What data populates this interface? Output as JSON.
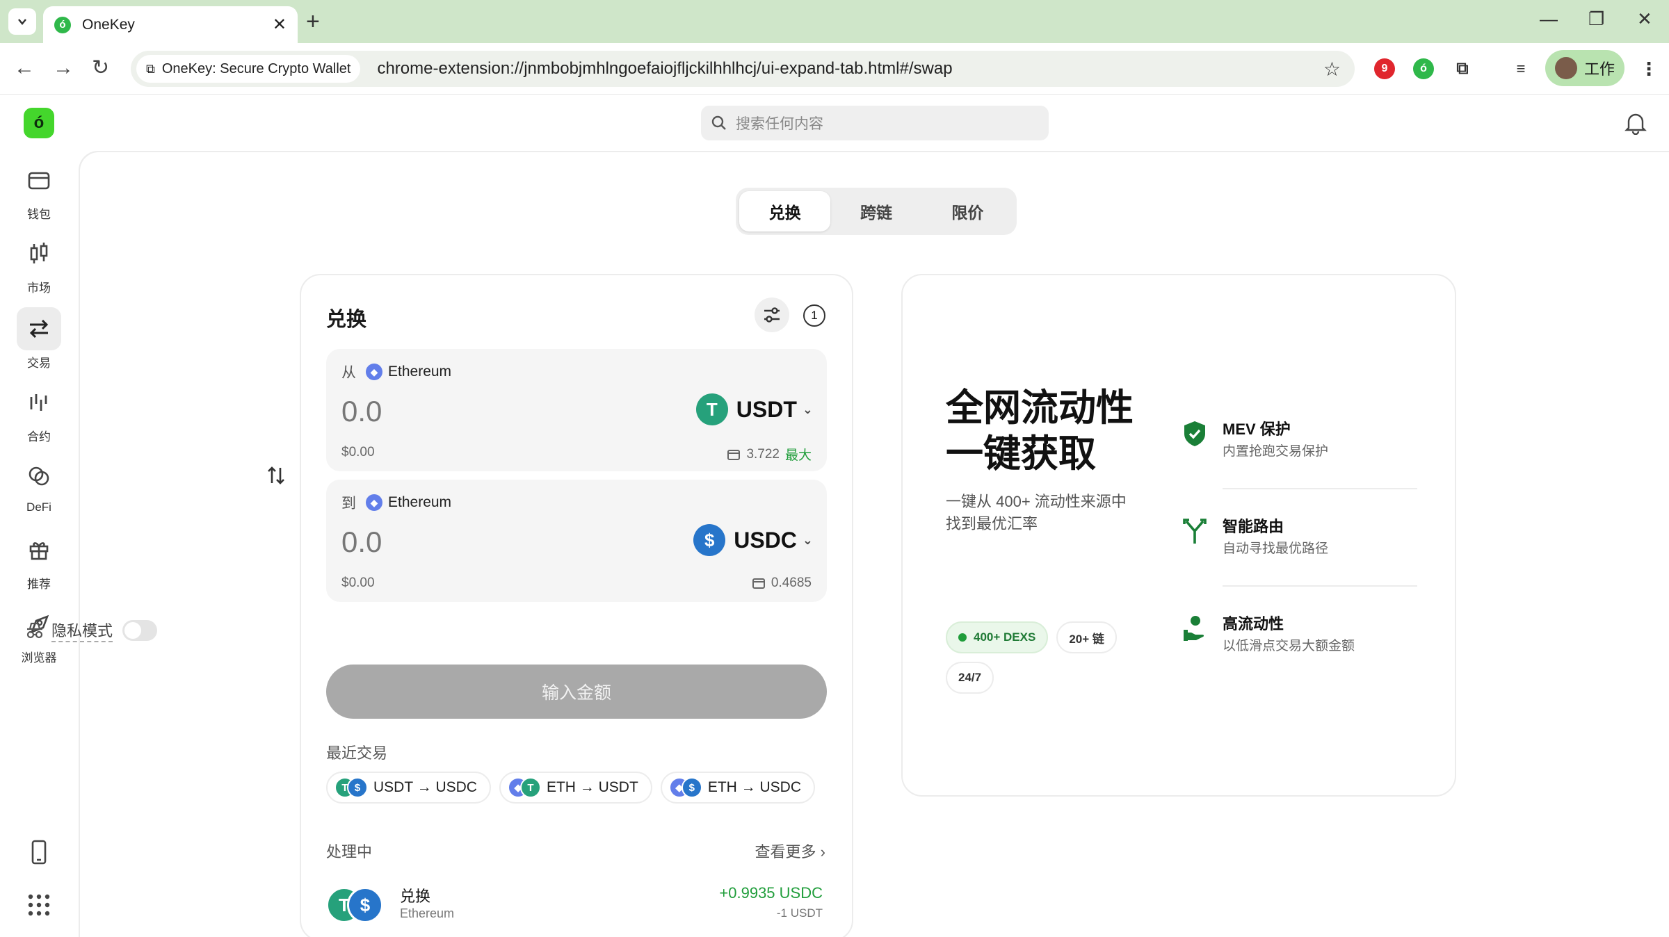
{
  "browser": {
    "tab_title": "OneKey",
    "site_chip": "OneKey: Secure Crypto Wallet",
    "url": "chrome-extension://jnmbobjmhlngoefaiojfljckilhhlhcj/ui-expand-tab.html#/swap",
    "profile_label": "工作"
  },
  "app": {
    "logo_glyph": "ó",
    "search_placeholder": "搜索任何内容",
    "sidebar": [
      {
        "label": "钱包",
        "icon": "wallet-icon"
      },
      {
        "label": "市场",
        "icon": "candlestick-icon"
      },
      {
        "label": "交易",
        "icon": "swap-arrows-icon"
      },
      {
        "label": "合约",
        "icon": "perp-chart-icon"
      },
      {
        "label": "DeFi",
        "icon": "defi-rings-icon"
      },
      {
        "label": "推荐",
        "icon": "gift-icon"
      },
      {
        "label": "浏览器",
        "icon": "compass-icon"
      }
    ]
  },
  "tabs": [
    "兑换",
    "跨链",
    "限价"
  ],
  "swap": {
    "title": "兑换",
    "pending_count": "1",
    "from": {
      "prefix": "从",
      "network": "Ethereum",
      "amount": "0.0",
      "token": "USDT",
      "usd": "$0.00",
      "balance": "3.722",
      "max_label": "最大"
    },
    "to": {
      "prefix": "到",
      "network": "Ethereum",
      "amount": "0.0",
      "token": "USDC",
      "usd": "$0.00",
      "balance": "0.4685"
    },
    "privacy_label": "隐私模式",
    "cta": "输入金额",
    "recent_title": "最近交易",
    "recent": [
      "USDT → USDC",
      "ETH → USDT",
      "ETH → USDC"
    ],
    "processing_title": "处理中",
    "see_more": "查看更多",
    "tx": {
      "name": "兑换",
      "network": "Ethereum",
      "received": "+0.9935 USDC",
      "sent": "-1 USDT"
    }
  },
  "promo": {
    "headline_1": "全网流动性",
    "headline_2": "一键获取",
    "sub_1": "一键从 400+ 流动性来源中",
    "sub_2": "找到最优汇率",
    "tags": [
      "400+ DEXS",
      "20+ 链",
      "24/7"
    ],
    "features": [
      {
        "title": "MEV 保护",
        "desc": "内置抢跑交易保护"
      },
      {
        "title": "智能路由",
        "desc": "自动寻找最优路径"
      },
      {
        "title": "高流动性",
        "desc": "以低滑点交易大额金额"
      }
    ]
  },
  "colors": {
    "brand_green": "#44d62c",
    "accent_green": "#1f9d3a",
    "usdt": "#26a17b",
    "usdc": "#2775ca",
    "eth": "#627eea"
  }
}
